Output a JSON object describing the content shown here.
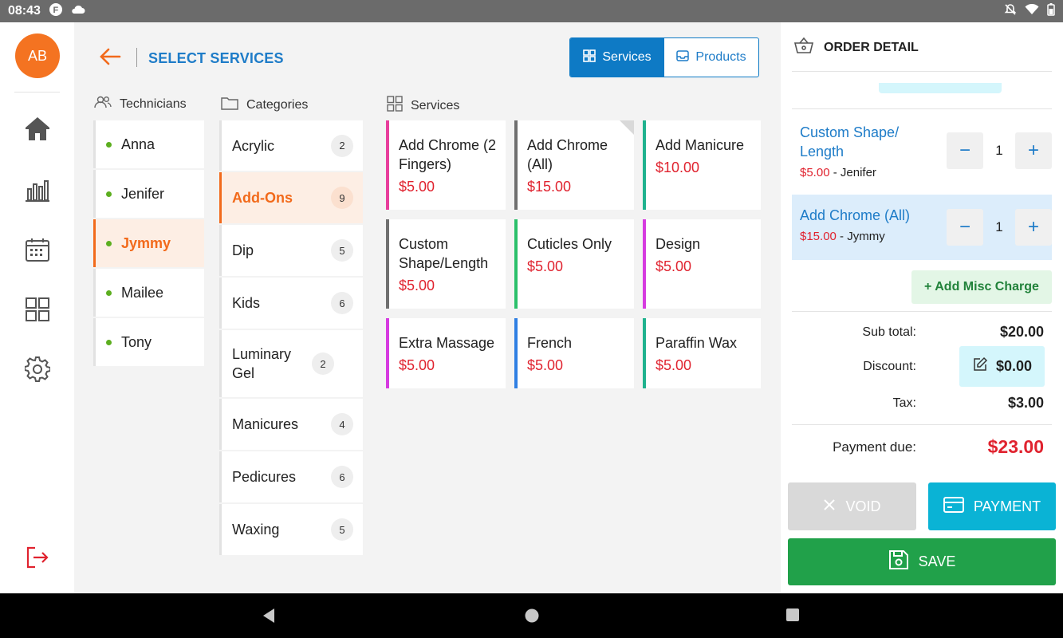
{
  "status_bar": {
    "time": "08:43"
  },
  "user": {
    "initials": "AB"
  },
  "header": {
    "title": "SELECT SERVICES"
  },
  "toggle": {
    "services_label": "Services",
    "products_label": "Products"
  },
  "columns": {
    "technicians": "Technicians",
    "categories": "Categories",
    "services": "Services"
  },
  "technicians": [
    {
      "name": "Anna",
      "active": false
    },
    {
      "name": "Jenifer",
      "active": false
    },
    {
      "name": "Jymmy",
      "active": true
    },
    {
      "name": "Mailee",
      "active": false
    },
    {
      "name": "Tony",
      "active": false
    }
  ],
  "categories": [
    {
      "name": "Acrylic",
      "count": "2",
      "active": false
    },
    {
      "name": "Add-Ons",
      "count": "9",
      "active": true
    },
    {
      "name": "Dip",
      "count": "5",
      "active": false
    },
    {
      "name": "Kids",
      "count": "6",
      "active": false
    },
    {
      "name": "Luminary Gel",
      "count": "2",
      "active": false
    },
    {
      "name": "Manicures",
      "count": "4",
      "active": false
    },
    {
      "name": "Pedicures",
      "count": "6",
      "active": false
    },
    {
      "name": "Waxing",
      "count": "5",
      "active": false
    }
  ],
  "services": [
    {
      "name": "Add Chrome (2 Fingers)",
      "price": "$5.00",
      "color": "#e83e9c"
    },
    {
      "name": "Add Chrome (All)",
      "price": "$15.00",
      "color": "#6f6f6f"
    },
    {
      "name": "Add Manicure",
      "price": "$10.00",
      "color": "#1fb28e"
    },
    {
      "name": "Custom Shape/Length",
      "price": "$5.00",
      "color": "#6f6f6f"
    },
    {
      "name": "Cuticles Only",
      "price": "$5.00",
      "color": "#2ac06a"
    },
    {
      "name": "Design",
      "price": "$5.00",
      "color": "#d63be0"
    },
    {
      "name": "Extra Massage",
      "price": "$5.00",
      "color": "#d63be0"
    },
    {
      "name": "French",
      "price": "$5.00",
      "color": "#2f7fe3"
    },
    {
      "name": "Paraffin Wax",
      "price": "$5.00",
      "color": "#1fb28e"
    }
  ],
  "order": {
    "title": "ORDER DETAIL",
    "items": [
      {
        "name": "Custom Shape/ Length",
        "price": "$5.00",
        "sep": " - ",
        "tech": "Jenifer",
        "qty": "1"
      },
      {
        "name": "Add Chrome (All)",
        "price": "$15.00",
        "sep": " - ",
        "tech": "Jymmy",
        "qty": "1"
      }
    ],
    "add_misc_label": "+ Add Misc Charge",
    "subtotal_label": "Sub total:",
    "subtotal": "$20.00",
    "discount_label": "Discount:",
    "discount": "$0.00",
    "tax_label": "Tax:",
    "tax": "$3.00",
    "due_label": "Payment due:",
    "due": "$23.00",
    "void_label": "VOID",
    "payment_label": "PAYMENT",
    "save_label": "SAVE"
  }
}
